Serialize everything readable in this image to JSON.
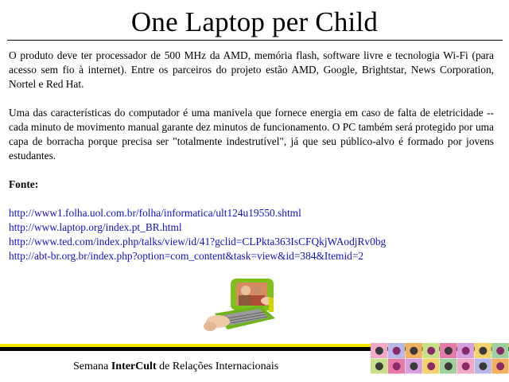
{
  "slide": {
    "title": "One Laptop per Child",
    "paragraph_1": "O produto deve ter processador de 500 MHz da AMD, memória flash, software livre e tecnologia Wi-Fi (para acesso sem fio à internet). Entre os parceiros do projeto estão AMD, Google, Brightstar, News Corporation, Nortel e Red Hat.",
    "paragraph_2": "Uma das características do computador é uma manivela que fornece energia em caso de falta de eletricidade --cada minuto de movimento manual garante dez minutos de funcionamento. O PC também será protegido por uma capa de borracha porque precisa ser \"totalmente indestrutível\", já que seu público-alvo é formado por jovens estudantes.",
    "source_label": "Fonte:",
    "links": [
      "http://www1.folha.uol.com.br/folha/informatica/ult124u19550.shtml",
      "http://www.laptop.org/index.pt_BR.html",
      "http://www.ted.com/index.php/talks/view/id/41?gclid=CLPkta363IsCFQkjWAodjRv0bg",
      "http://abt-br.org.br/index.php?option=com_content&task=view&id=384&Itemid=2"
    ],
    "image": {
      "icon": "green-laptop-photo"
    }
  },
  "footer": {
    "prefix": "Semana ",
    "brand": "InterCult",
    "suffix": " de Relações Internacionais",
    "bar_colors": {
      "yellow": "#f2e600",
      "black": "#000000"
    }
  },
  "colors": {
    "link": "#1010c8",
    "text": "#000000",
    "background": "#ffffff"
  }
}
